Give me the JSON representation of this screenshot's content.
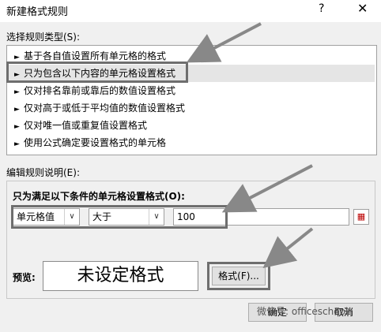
{
  "window": {
    "title": "新建格式规则",
    "help_glyph": "?",
    "close_glyph": "✕"
  },
  "rule_type": {
    "label": "选择规则类型(S):",
    "items": [
      {
        "label": "基于各自值设置所有单元格的格式"
      },
      {
        "label": "只为包含以下内容的单元格设置格式"
      },
      {
        "label": "仅对排名靠前或靠后的数值设置格式"
      },
      {
        "label": "仅对高于或低于平均值的数值设置格式"
      },
      {
        "label": "仅对唯一值或重复值设置格式"
      },
      {
        "label": "使用公式确定要设置格式的单元格"
      }
    ],
    "selected_index": 1
  },
  "description": {
    "label": "编辑规则说明(E):",
    "subtitle": "只为满足以下条件的单元格设置格式(O):",
    "field_select": "单元格值",
    "operator_select": "大于",
    "value": "100"
  },
  "preview": {
    "label": "预览:",
    "text": "未设定格式",
    "format_button": "格式(F)..."
  },
  "footer": {
    "ok_button": "确定",
    "cancel_button": "取消",
    "watermark": "微信号: officeschool"
  }
}
